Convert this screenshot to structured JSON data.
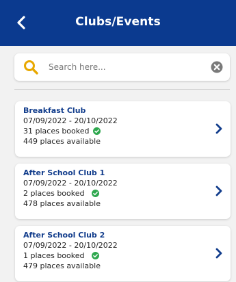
{
  "header": {
    "title": "Clubs/Events"
  },
  "search": {
    "placeholder": "Search here..."
  },
  "colors": {
    "brand": "#0b3a8f",
    "search_icon": "#e8a800",
    "check": "#2fa84f"
  },
  "clubs": [
    {
      "name": "Breakfast Club",
      "dates": "07/09/2022 - 20/10/2022",
      "booked": "31 places booked",
      "available": "449 places available"
    },
    {
      "name": "After School Club 1",
      "dates": "07/09/2022 - 20/10/2022",
      "booked": "2 places booked",
      "available": "478 places available"
    },
    {
      "name": "After School Club 2",
      "dates": "07/09/2022 - 20/10/2022",
      "booked": "1 places booked",
      "available": "479 places available"
    }
  ]
}
